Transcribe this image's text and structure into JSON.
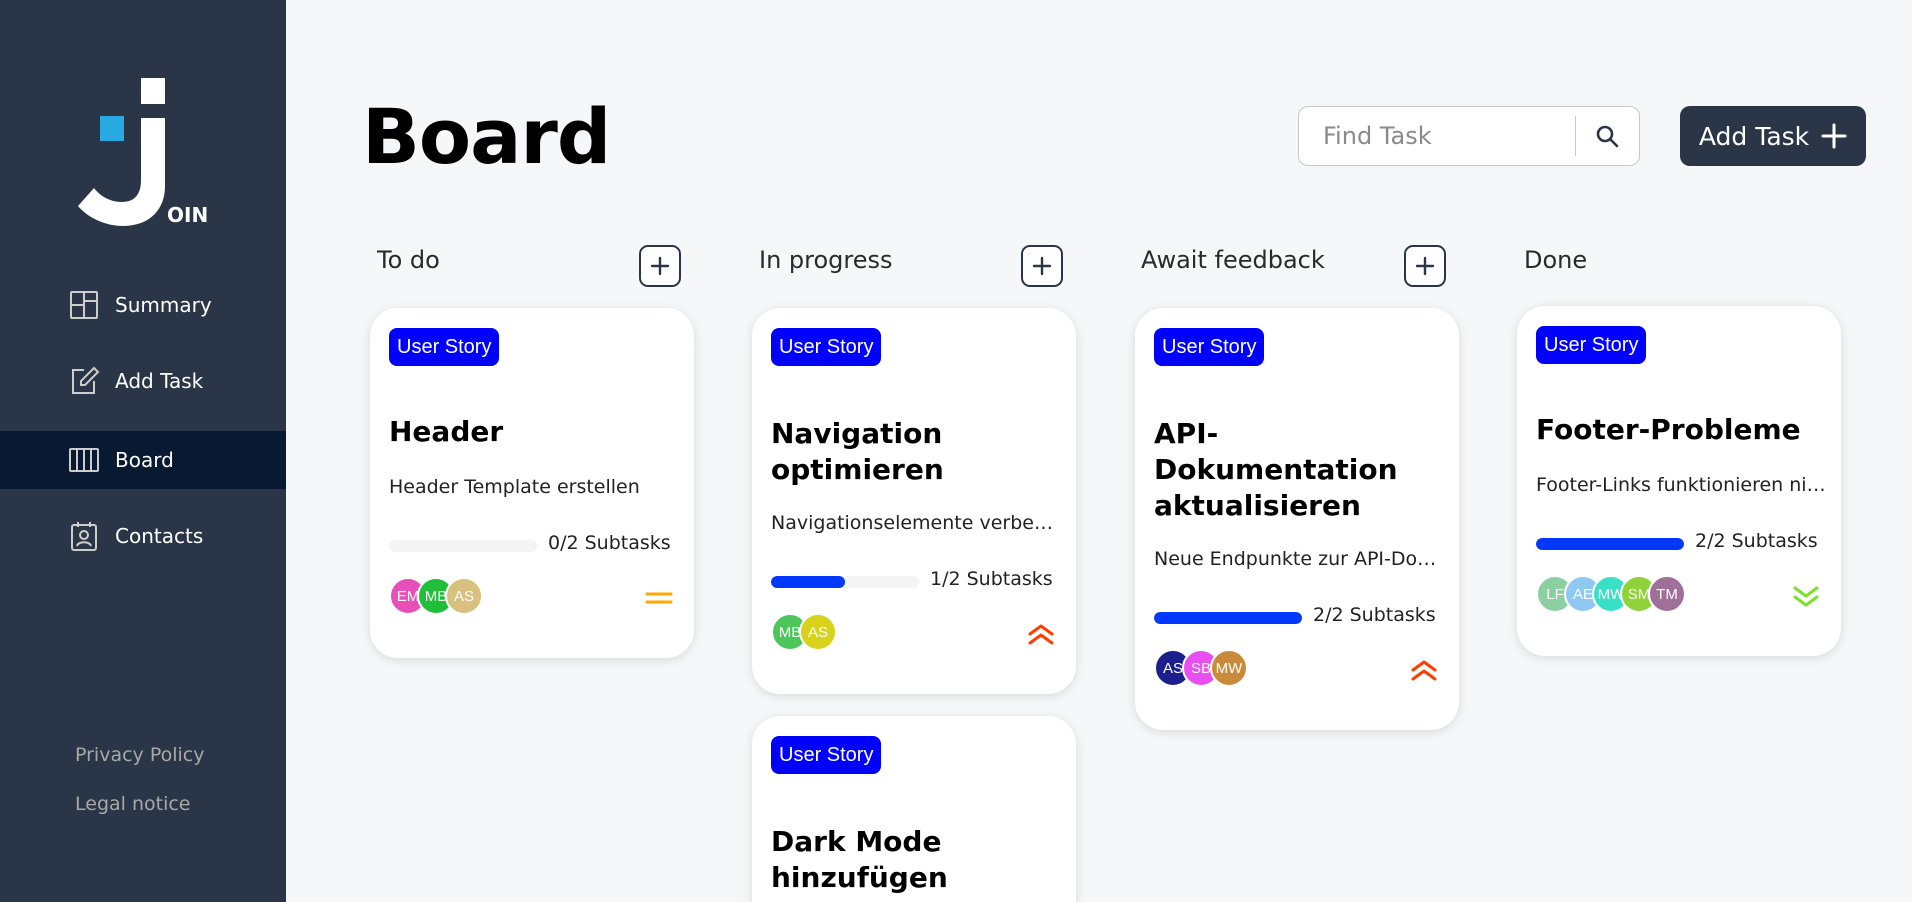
{
  "sidebar": {
    "logo_text": "OIN",
    "items": [
      {
        "label": "Summary",
        "icon": "summary-icon",
        "active": false
      },
      {
        "label": "Add Task",
        "icon": "add-task-icon",
        "active": false
      },
      {
        "label": "Board",
        "icon": "board-icon",
        "active": true
      },
      {
        "label": "Contacts",
        "icon": "contacts-icon",
        "active": false
      }
    ],
    "privacy": "Privacy Policy",
    "legal": "Legal notice"
  },
  "header": {
    "title": "Board",
    "search_placeholder": "Find Task",
    "add_task_label": "Add Task"
  },
  "columns": [
    {
      "title": "To do"
    },
    {
      "title": "In progress"
    },
    {
      "title": "Await feedback"
    },
    {
      "title": "Done"
    }
  ],
  "cards": {
    "header": {
      "category": "User Story",
      "title": "Header",
      "description": "Header Template erstellen",
      "progress": 0.0,
      "subtasks": "0/2 Subtasks",
      "priority": "medium",
      "avatars": [
        {
          "initials": "EM",
          "color": "#e84fb8"
        },
        {
          "initials": "MB",
          "color": "#1fbf3a"
        },
        {
          "initials": "AS",
          "color": "#d8c07e"
        }
      ]
    },
    "navigation": {
      "category": "User Story",
      "title": "Navigation optimieren",
      "description": "Navigationselemente verbessern",
      "progress": 0.5,
      "subtasks": "1/2 Subtasks",
      "priority": "urgent",
      "avatars": [
        {
          "initials": "MB",
          "color": "#4cc55a"
        },
        {
          "initials": "AS",
          "color": "#d9d21a"
        }
      ]
    },
    "darkmode": {
      "category": "User Story",
      "title": "Dark Mode hinzufügen"
    },
    "api": {
      "category": "User Story",
      "title": "API-Dokumentation aktualisieren",
      "description": "Neue Endpunkte zur API-Dokumentation",
      "progress": 1.0,
      "subtasks": "2/2 Subtasks",
      "priority": "urgent",
      "avatars": [
        {
          "initials": "AS",
          "color": "#1b1f8c"
        },
        {
          "initials": "SB",
          "color": "#e94ff0"
        },
        {
          "initials": "MW",
          "color": "#c98b3a"
        }
      ]
    },
    "footer": {
      "category": "User Story",
      "title": "Footer-Probleme",
      "description": "Footer-Links funktionieren nicht",
      "progress": 1.0,
      "subtasks": "2/2 Subtasks",
      "priority": "low",
      "avatars": [
        {
          "initials": "LF",
          "color": "#8ccfa0"
        },
        {
          "initials": "AE",
          "color": "#8fc8f0"
        },
        {
          "initials": "MW",
          "color": "#39e0c8"
        },
        {
          "initials": "SM",
          "color": "#8fd23a"
        },
        {
          "initials": "TM",
          "color": "#a0709a"
        }
      ]
    }
  },
  "colors": {
    "sidebar": "#2a3647",
    "active_nav": "#091931",
    "category": "#0000ff",
    "progress": "#0038ff",
    "urgent": "#ff3d00",
    "medium": "#ffa800",
    "low": "#7ae229"
  }
}
